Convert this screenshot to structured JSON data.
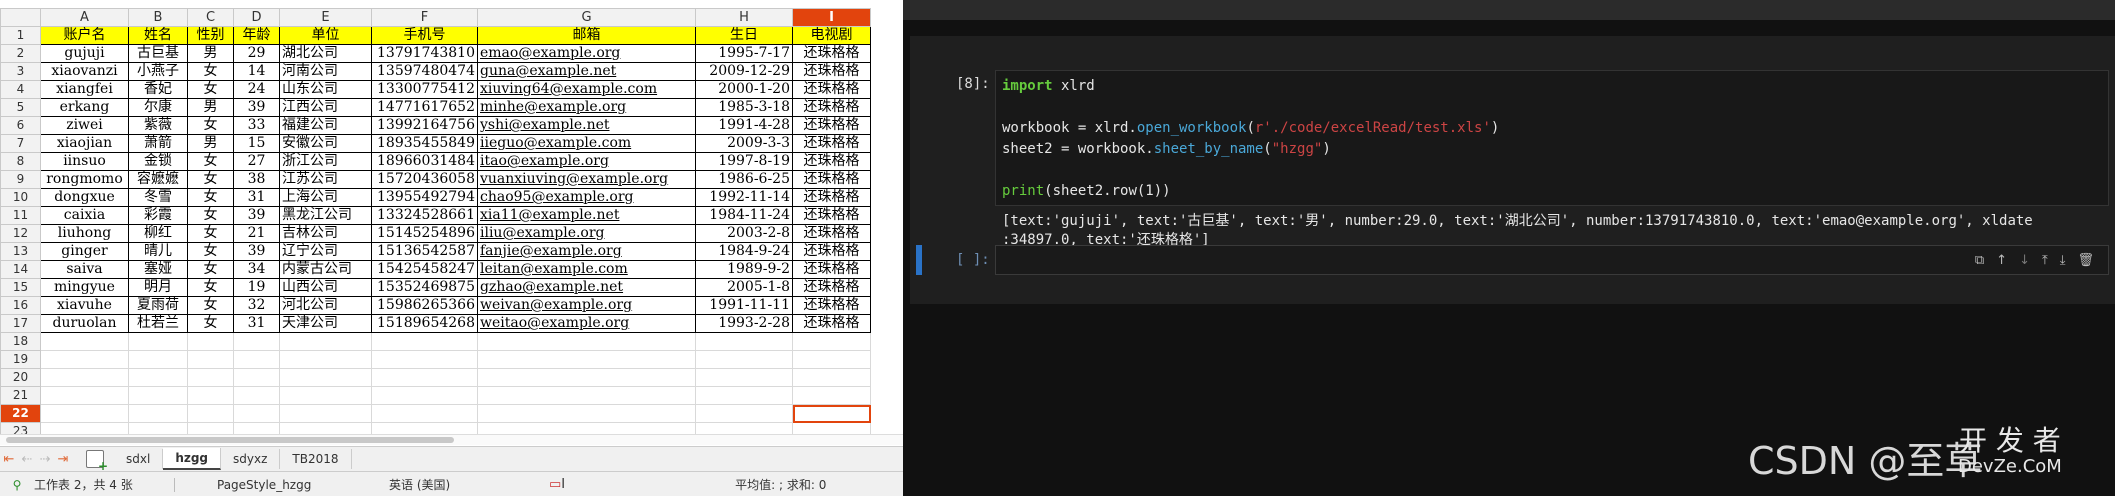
{
  "spreadsheet": {
    "columns": [
      "",
      "A",
      "B",
      "C",
      "D",
      "E",
      "F",
      "G",
      "H",
      "I"
    ],
    "header": [
      "账户名",
      "姓名",
      "性别",
      "年龄",
      "单位",
      "手机号",
      "邮箱",
      "生日",
      "电视剧"
    ],
    "rows": [
      [
        "gujuji",
        "古巨基",
        "男",
        "29",
        "湖北公司",
        "13791743810",
        "emao@example.org",
        "1995-7-17",
        "还珠格格"
      ],
      [
        "xiaovanzi",
        "小燕子",
        "女",
        "14",
        "河南公司",
        "13597480474",
        "guna@example.net",
        "2009-12-29",
        "还珠格格"
      ],
      [
        "xiangfei",
        "香妃",
        "女",
        "24",
        "山东公司",
        "13300775412",
        "xiuving64@example.com",
        "2000-1-20",
        "还珠格格"
      ],
      [
        "erkang",
        "尔康",
        "男",
        "39",
        "江西公司",
        "14771617652",
        "minhe@example.org",
        "1985-3-18",
        "还珠格格"
      ],
      [
        "ziwei",
        "紫薇",
        "女",
        "33",
        "福建公司",
        "13992164756",
        "yshi@example.net",
        "1991-4-28",
        "还珠格格"
      ],
      [
        "xiaojian",
        "萧箭",
        "男",
        "15",
        "安徽公司",
        "18935455849",
        "iieguo@example.com",
        "2009-3-3",
        "还珠格格"
      ],
      [
        "iinsuo",
        "金锁",
        "女",
        "27",
        "浙江公司",
        "18966031484",
        "itao@example.org",
        "1997-8-19",
        "还珠格格"
      ],
      [
        "rongmomo",
        "容嬷嬷",
        "女",
        "38",
        "江苏公司",
        "15720436058",
        "vuanxiuving@example.org",
        "1986-6-25",
        "还珠格格"
      ],
      [
        "dongxue",
        "冬雪",
        "女",
        "31",
        "上海公司",
        "13955492794",
        "chao95@example.org",
        "1992-11-14",
        "还珠格格"
      ],
      [
        "caixia",
        "彩霞",
        "女",
        "39",
        "黑龙江公司",
        "13324528661",
        "xia11@example.net",
        "1984-11-24",
        "还珠格格"
      ],
      [
        "liuhong",
        "柳红",
        "女",
        "21",
        "吉林公司",
        "15145254896",
        "iliu@example.org",
        "2003-2-8",
        "还珠格格"
      ],
      [
        "ginger",
        "晴儿",
        "女",
        "39",
        "辽宁公司",
        "15136542587",
        "fanjie@example.org",
        "1984-9-24",
        "还珠格格"
      ],
      [
        "saiva",
        "塞娅",
        "女",
        "34",
        "内蒙古公司",
        "15425458247",
        "leitan@example.com",
        "1989-9-2",
        "还珠格格"
      ],
      [
        "mingyue",
        "明月",
        "女",
        "19",
        "山西公司",
        "15352469875",
        "gzhao@example.net",
        "2005-1-8",
        "还珠格格"
      ],
      [
        "xiavuhe",
        "夏雨荷",
        "女",
        "32",
        "河北公司",
        "15986265366",
        "weivan@example.org",
        "1991-11-11",
        "还珠格格"
      ],
      [
        "duruolan",
        "杜若兰",
        "女",
        "31",
        "天津公司",
        "15189654268",
        "weitao@example.org",
        "1993-2-28",
        "还珠格格"
      ]
    ],
    "empty_rows": [
      "18",
      "19",
      "20",
      "21",
      "22",
      "23"
    ]
  },
  "sheet_tabs": [
    "sdxl",
    "hzgg",
    "sdyxz",
    "TB2018"
  ],
  "active_tab": "hzgg",
  "status": {
    "sheet_info": "工作表 2，共 4 张",
    "page_style": "PageStyle_hzgg",
    "language": "英语 (美国)",
    "summary": "平均值: ; 求和: 0"
  },
  "notebook": {
    "prompt": "[8]:",
    "code": {
      "l1_kw": "import",
      "l1_rest": " xlrd",
      "l3_a": "workbook = xlrd.",
      "l3_fn": "open_workbook",
      "l3_b": "(",
      "l3_str": "r'./code/excelRead/test.xls'",
      "l3_c": ")",
      "l4_a": "sheet2 = workbook.",
      "l4_fn": "sheet_by_name",
      "l4_b": "(",
      "l4_str": "\"hzgg\"",
      "l4_c": ")",
      "l6_kw": "print",
      "l6_rest": "(sheet2.row(1))"
    },
    "output_line1": "[text:'gujuji', text:'古巨基', text:'男', number:29.0, text:'湖北公司', number:13791743810.0, text:'emao@example.org', xldate",
    "output_line2": ":34897.0, text:'还珠格格']",
    "empty_prompt": "[ ]:"
  },
  "watermark": {
    "main": "CSDN @至草",
    "side_top": "开 发 者",
    "side_bottom": "DevZe.CoM"
  },
  "colors": {
    "header_fill": "#ffff00",
    "active_header": "#e2440d",
    "active_cell_bar": "#2a73c8",
    "keyword": "#66cc3d",
    "string": "#cc4444",
    "function": "#4aa8d8"
  }
}
